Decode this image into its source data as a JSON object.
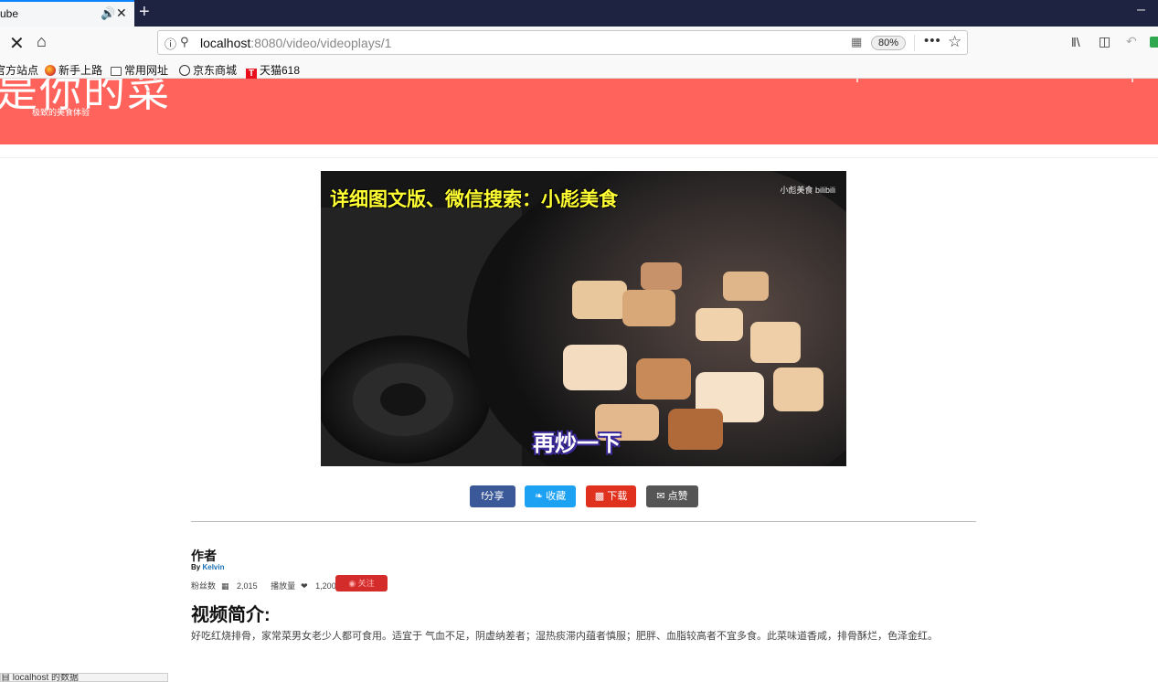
{
  "browser": {
    "tab_title": "ube",
    "new_tab_label": "+",
    "url_host": "localhost",
    "url_rest": ":8080/video/videoplays/1",
    "zoom": "80%",
    "more_label": "•••",
    "bookmarks": [
      {
        "label": "官方站点",
        "icon": "none"
      },
      {
        "label": "新手上路",
        "icon": "firefox-icon"
      },
      {
        "label": "常用网址",
        "icon": "folder-icon"
      },
      {
        "label": "京东商城",
        "icon": "globe-icon"
      },
      {
        "label": "天猫618",
        "icon": "tmall-icon"
      }
    ],
    "tmall_glyph": "T"
  },
  "hero": {
    "title": "是你的菜",
    "subtitle": "极致的美食体验",
    "color": "#ff635b"
  },
  "video": {
    "caption": "详细图文版、微信搜索：小彪美食",
    "watermark": "小彪美食 bilibili",
    "subtitle": "再炒一下"
  },
  "actions": {
    "share": "f分享",
    "favorite": "收藏",
    "download": "下载",
    "like": "点赞"
  },
  "author": {
    "heading": "作者",
    "by": "By",
    "name": "Kelvin",
    "fans_label": "粉丝数",
    "fans_value": "2,015",
    "plays_label": "播放量",
    "plays_value": "1,200",
    "follow_label": "关注"
  },
  "intro": {
    "heading": "视频简介:",
    "body": "好吃红烧排骨，家常菜男女老少人都可食用。适宜于 气血不足，阴虚纳差者；湿热痰滞内蕴者慎服；肥胖、血脂较高者不宜多食。此菜味道香咸，排骨酥烂，色泽金红。"
  },
  "status_bar": "自 localhost 的数据"
}
